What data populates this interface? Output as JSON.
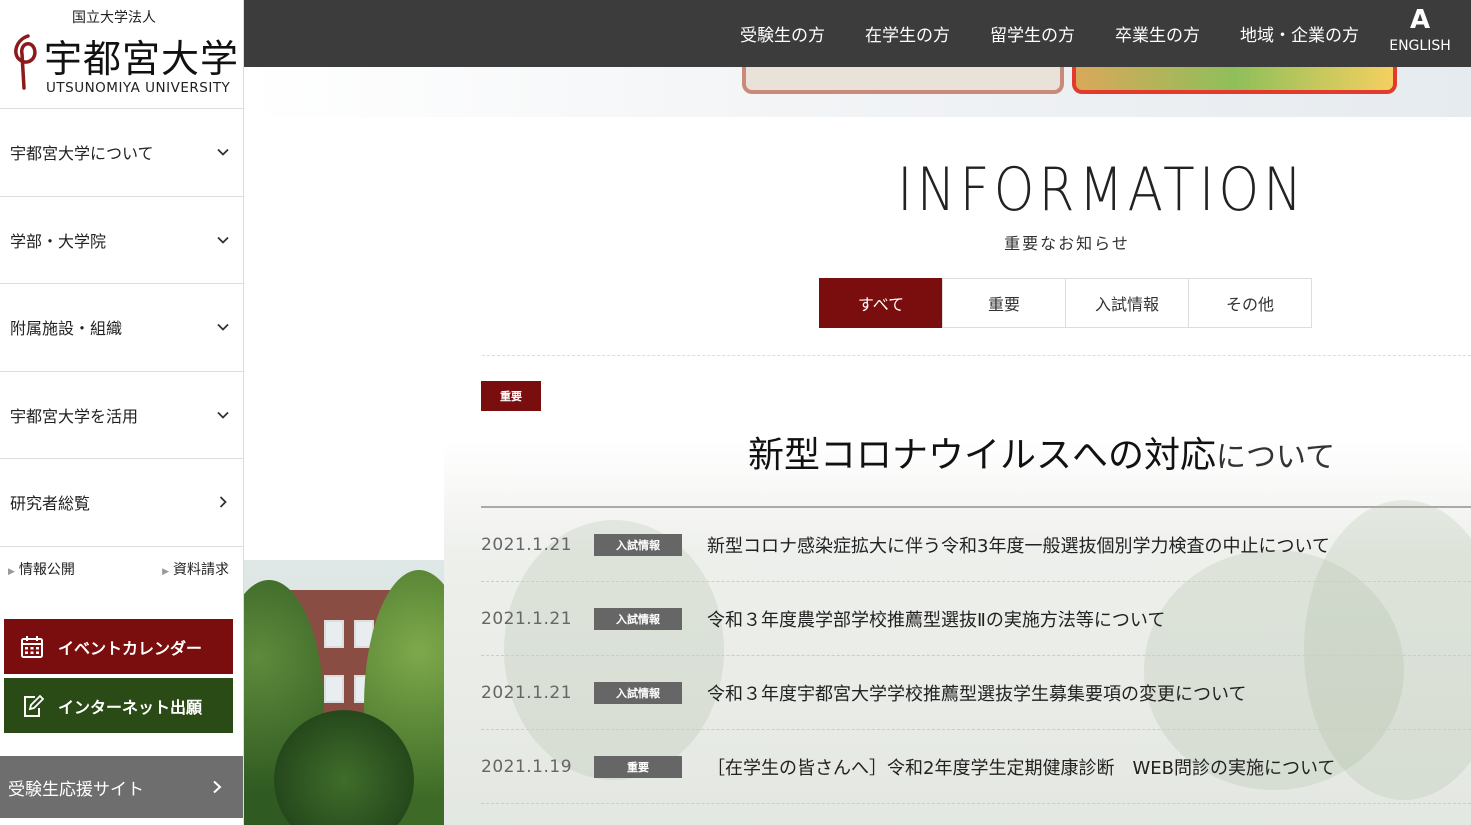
{
  "logo": {
    "sub": "国立大学法人",
    "main": "宇都宮大学",
    "english": "UTSUNOMIYA UNIVERSITY"
  },
  "topnav": {
    "items": [
      "受験生の方",
      "在学生の方",
      "留学生の方",
      "卒業生の方",
      "地域・企業の方"
    ],
    "english_icon": "A",
    "english_label": "ENGLISH"
  },
  "sidebar": {
    "items": [
      {
        "label": "宇都宮大学について",
        "icon": "chevron-down-icon"
      },
      {
        "label": "学部・大学院",
        "icon": "chevron-down-icon"
      },
      {
        "label": "附属施設・組織",
        "icon": "chevron-down-icon"
      },
      {
        "label": "宇都宮大学を活用",
        "icon": "chevron-down-icon"
      },
      {
        "label": "研究者総覧",
        "icon": "chevron-right-icon"
      }
    ],
    "links": [
      "情報公開",
      "資料請求"
    ],
    "calendar_button": "イベントカレンダー",
    "apply_button": "インターネット出願",
    "support_site": "受験生応援サイト"
  },
  "info": {
    "title": "INFORMATION",
    "subtitle": "重要なお知らせ",
    "tabs": [
      "すべて",
      "重要",
      "入試情報",
      "その他"
    ],
    "active_tab": 0
  },
  "featured": {
    "badge": "重要",
    "title": "新型コロナウイルスへの対応",
    "title_suffix": "について"
  },
  "news": [
    {
      "date": "2021.1.21",
      "category": "入試情報",
      "title": "新型コロナ感染症拡大に伴う令和3年度一般選抜個別学力検査の中止について"
    },
    {
      "date": "2021.1.21",
      "category": "入試情報",
      "title": "令和３年度農学部学校推薦型選抜Ⅱの実施方法等について"
    },
    {
      "date": "2021.1.21",
      "category": "入試情報",
      "title": "令和３年度宇都宮大学学校推薦型選抜学生募集要項の変更について"
    },
    {
      "date": "2021.1.19",
      "category": "重要",
      "title": "［在学生の皆さんへ］令和2年度学生定期健康診断　WEB問診の実施について"
    }
  ],
  "colors": {
    "accent": "#7a0d0d",
    "apply_green": "#2a4a16",
    "topbar": "#3c3c3c",
    "support_grey": "#6e6e6e"
  }
}
